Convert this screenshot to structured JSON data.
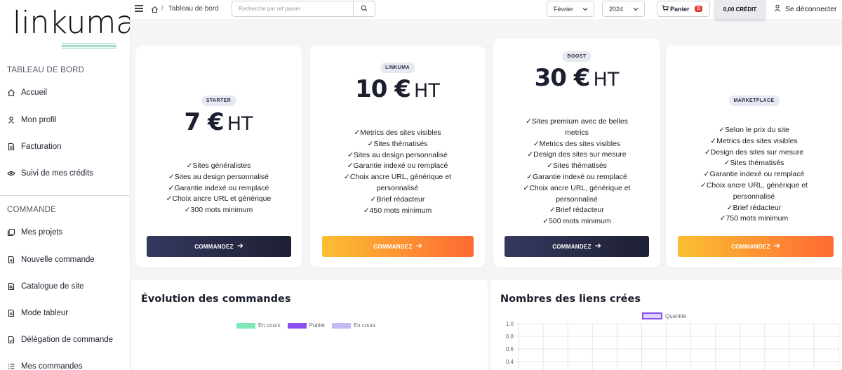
{
  "logo": {
    "text": "linkuma"
  },
  "sidebar": {
    "section1_title": "TABLEAU DE BORD",
    "section1_items": [
      {
        "label": "Accueil",
        "icon": "home-icon"
      },
      {
        "label": "Mon profil",
        "icon": "user-icon"
      },
      {
        "label": "Facturation",
        "icon": "invoice-icon"
      },
      {
        "label": "Suivi de mes crédits",
        "icon": "eye-icon"
      }
    ],
    "section2_title": "COMMANDE",
    "section2_items": [
      {
        "label": "Mes projets",
        "icon": "projects-icon"
      },
      {
        "label": "Nouvelle commande",
        "icon": "new-order-icon"
      },
      {
        "label": "Catalogue de site",
        "icon": "catalog-icon"
      },
      {
        "label": "Mode tableur",
        "icon": "spreadsheet-icon"
      },
      {
        "label": "Délégation de commande",
        "icon": "delegation-icon"
      },
      {
        "label": "Mes commandes",
        "icon": "list-icon"
      }
    ]
  },
  "topbar": {
    "breadcrumb_sep": "/",
    "breadcrumb": "Tableau de bord",
    "search_placeholder": "Recherche par ref panier",
    "month": "Février",
    "year": "2024",
    "cart_label": "Panier",
    "cart_count": "0",
    "credit": "0,00 CRÉDIT",
    "logout": "Se déconnecter"
  },
  "plans": [
    {
      "badge": "STARTER",
      "price": "7 €",
      "unit": "HT",
      "features": [
        "Sites généralistes",
        "Sites au design personnalisé",
        "Garantie indexé ou remplacé",
        "Choix ancre URL et générique",
        "300 mots minimum"
      ],
      "cta": "COMMANDEZ",
      "style": "dark"
    },
    {
      "badge": "LINKUMA",
      "price": "10 €",
      "unit": "HT",
      "features": [
        "Metrics des sites visibles",
        "Sites thématisés",
        "Sites au design personnalisé",
        "Garantie indexé ou remplacé",
        "Choix ancre URL, générique et personnalisé",
        "Brief rédacteur",
        "450 mots minimum"
      ],
      "cta": "COMMANDEZ",
      "style": "orange"
    },
    {
      "badge": "BOOST",
      "price": "30 €",
      "unit": "HT",
      "features": [
        "Sites premium avec de belles metrics",
        "Metrics des sites visibles",
        "Design des sites sur mesure",
        "Sites thématisés",
        "Garantie indexé ou remplacé",
        "Choix ancre URL, générique et personnalisé",
        "Brief rédacteur",
        "500 mots minimum"
      ],
      "cta": "COMMANDEZ",
      "style": "dark"
    },
    {
      "badge": "MARKETPLACE",
      "price": "",
      "unit": "",
      "features": [
        "Selon le prix du site",
        "Metrics des sites visibles",
        "Design des sites sur mesure",
        "Sites thématisés",
        "Garantie indexé ou remplacé",
        "Choix ancre URL, générique et personnalisé",
        "Brief rédacteur",
        "750 mots minimum"
      ],
      "cta": "COMMANDEZ",
      "style": "orange"
    }
  ],
  "orders_panel": {
    "title": "Évolution des commandes",
    "legend": [
      {
        "label": "En cours",
        "color": "#7ee8b8"
      },
      {
        "label": "Publié",
        "color": "#8a4ff0"
      },
      {
        "label": "En cours",
        "color": "#c6b8f2"
      }
    ]
  },
  "chart_data": {
    "type": "bar",
    "title": "Nombres des liens crées",
    "series": [
      {
        "name": "Quantité",
        "values": []
      }
    ],
    "legend_color": "#c6b8f2",
    "yticks": [
      "1.0",
      "0.8",
      "0.6",
      "0.4"
    ],
    "ylim": [
      0,
      1
    ],
    "grid": true,
    "legend_position": "top"
  }
}
